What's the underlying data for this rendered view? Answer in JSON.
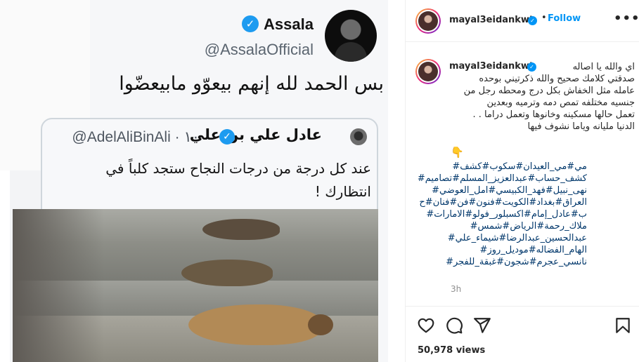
{
  "post_image": {
    "tweet": {
      "author_name": "Assala",
      "author_handle": "@AssalaOfficial",
      "text": "بس الحمد لله إنهم بيعوّو مابيعضّوا"
    },
    "quoted_tweet": {
      "author_name": "عادل علي بن علي",
      "author_handle": "@AdelAliBinAli · ١٠",
      "text": "عند كل درجة من درجات النجاح ستجد كلباً في انتظارك !"
    }
  },
  "header": {
    "username": "mayal3eidankwt",
    "dot": "•",
    "follow_label": "Follow",
    "more_label": "•••"
  },
  "caption": {
    "username": "mayal3eidankwt",
    "text": "اي والله يا اصاله\nصدقتي كلامك صحيح والله ذكرتيني بوحده\nعامله مثل الخفاش بكل درج ومحطه رجل من\nجنسيه مختلفه تمص دمه وترميه وبعدين\nتعمل حالها مسكينه وخانوها وتعمل دراما . .\nالدنيا مليانه وياما نشوف فيها",
    "emoji": "👇",
    "hashtags": "مي#مي_العيدان#سكوب#كشف#\nكشف_حساب#عبدالعزيز_المسلم#تصاميم#\nنهى_نبيل#فهد_الكبيسي#امل_العوضي#\nالعراق#بغداد#الكويت#فنون#فن#فنان#ح\nب#عادل_إمام#اكسبلور_فولو#الامارات#\nملاك_رحمة#الرياض#شمس#\nعبدالحسين_عبدالرضا#شيماء_علي#\nالهام_الفضاله#موديل_روز#\nنانسي_عجرم#شجون#غبقة_للفجر#",
    "time": "3h"
  },
  "actions": {
    "views": "50,978 views"
  },
  "icons": {
    "like": "heart-icon",
    "comment": "comment-icon",
    "share": "share-icon",
    "save": "bookmark-icon",
    "verified": "verified-badge-icon"
  },
  "colors": {
    "link_blue": "#0095f6",
    "hashtag": "#00376b",
    "verified": "#0095f6",
    "twitter_verified": "#1d9bf0"
  }
}
